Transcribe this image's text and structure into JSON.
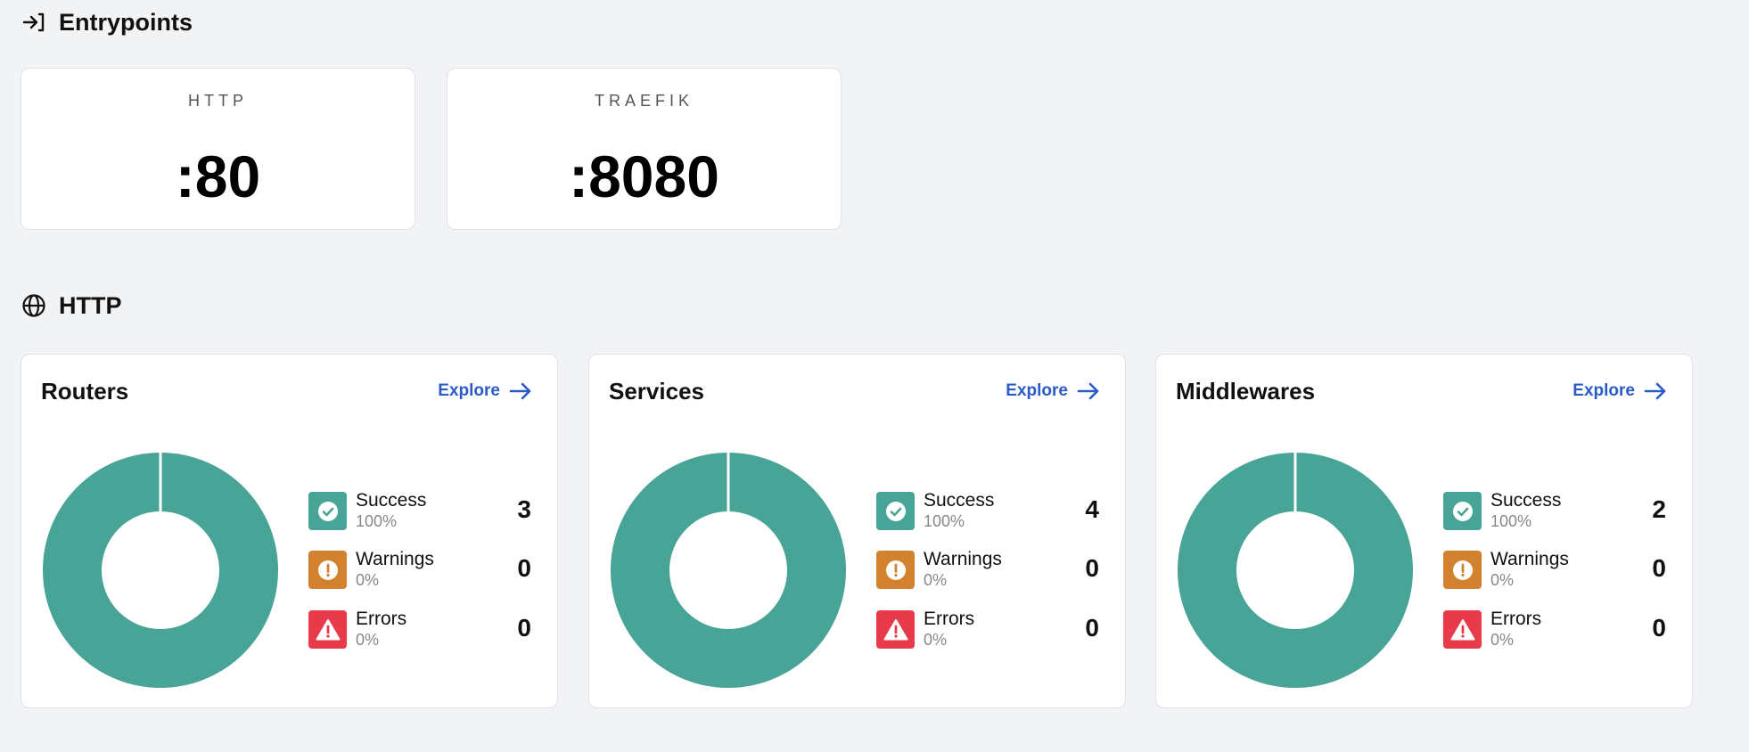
{
  "entrypoints_section": {
    "title": "Entrypoints",
    "icon": "entrypoint-arrow-icon"
  },
  "entrypoints": [
    {
      "name": "HTTP",
      "port": ":80"
    },
    {
      "name": "TRAEFIK",
      "port": ":8080"
    }
  ],
  "http_section": {
    "title": "HTTP",
    "icon": "globe-icon"
  },
  "colors": {
    "success": "#47a497",
    "warning": "#d2822e",
    "error": "#e83a4a",
    "link": "#2a5bc6"
  },
  "cards": [
    {
      "title": "Routers",
      "explore": "Explore",
      "success": {
        "label": "Success",
        "pct": "100%",
        "count": "3"
      },
      "warnings": {
        "label": "Warnings",
        "pct": "0%",
        "count": "0"
      },
      "errors": {
        "label": "Errors",
        "pct": "0%",
        "count": "0"
      }
    },
    {
      "title": "Services",
      "explore": "Explore",
      "success": {
        "label": "Success",
        "pct": "100%",
        "count": "4"
      },
      "warnings": {
        "label": "Warnings",
        "pct": "0%",
        "count": "0"
      },
      "errors": {
        "label": "Errors",
        "pct": "0%",
        "count": "0"
      }
    },
    {
      "title": "Middlewares",
      "explore": "Explore",
      "success": {
        "label": "Success",
        "pct": "100%",
        "count": "2"
      },
      "warnings": {
        "label": "Warnings",
        "pct": "0%",
        "count": "0"
      },
      "errors": {
        "label": "Errors",
        "pct": "0%",
        "count": "0"
      }
    }
  ]
}
